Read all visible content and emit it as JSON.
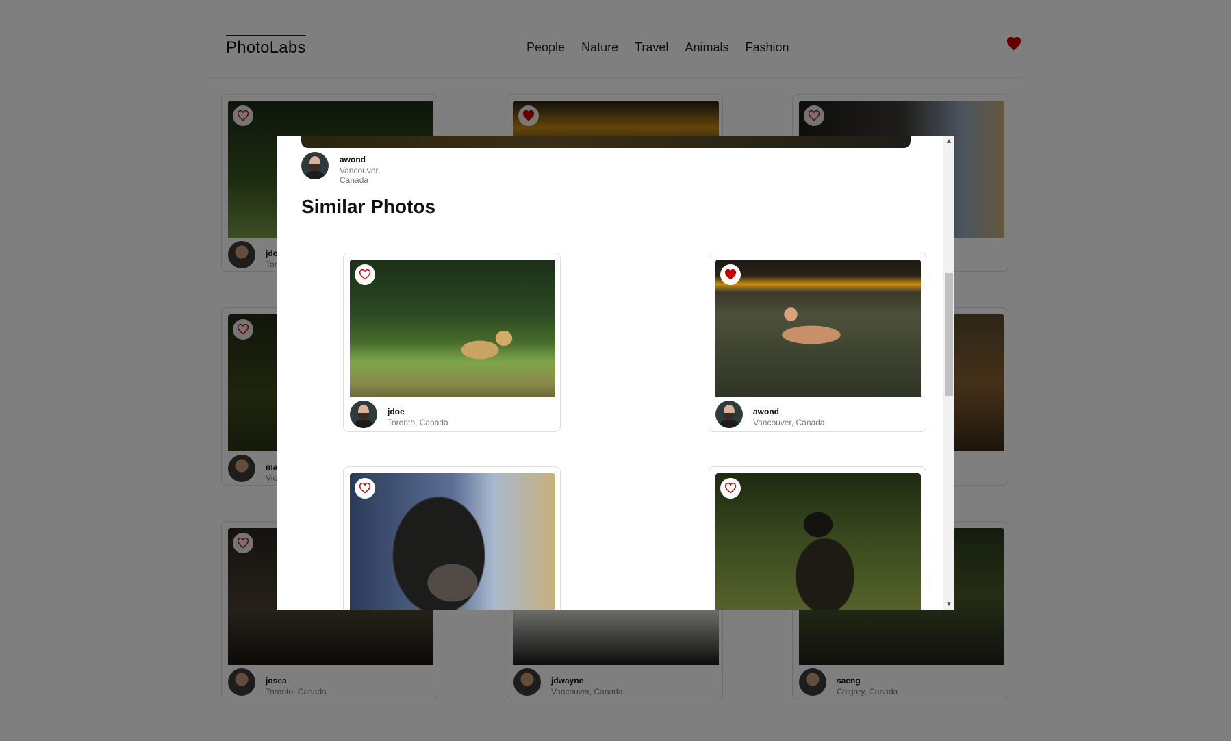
{
  "app": {
    "logo": "PhotoLabs",
    "topics": [
      "People",
      "Nature",
      "Travel",
      "Animals",
      "Fashion"
    ]
  },
  "colors": {
    "accent_red": "#c40000",
    "overlay": "rgba(0,0,0,0.5)"
  },
  "background_grid": [
    {
      "liked": false,
      "username": "jdoe",
      "location": "Toronto, Canada"
    },
    {
      "liked": true,
      "username": "",
      "location": ""
    },
    {
      "liked": false,
      "username": "",
      "location": ""
    },
    {
      "liked": false,
      "username": "ma",
      "location": "Vic"
    },
    {
      "liked": false,
      "username": "",
      "location": ""
    },
    {
      "liked": false,
      "username": "",
      "location": ""
    },
    {
      "liked": false,
      "username": "josea",
      "location": "Toronto, Canada"
    },
    {
      "liked": false,
      "username": "jdwayne",
      "location": "Vancouver, Canada"
    },
    {
      "liked": false,
      "username": "saeng",
      "location": "Calgary, Canada"
    }
  ],
  "modal": {
    "main_photo_user": {
      "username": "awond",
      "location": "Vancouver, Canada"
    },
    "similar_title": "Similar Photos",
    "similar_photos": [
      {
        "username": "jdoe",
        "location": "Toronto, Canada",
        "liked": false,
        "image": "jaguar"
      },
      {
        "username": "awond",
        "location": "Vancouver, Canada",
        "liked": true,
        "image": "dog"
      },
      {
        "username": "",
        "location": "",
        "liked": false,
        "image": "black-dog"
      },
      {
        "username": "",
        "location": "",
        "liked": false,
        "image": "cat"
      }
    ]
  }
}
